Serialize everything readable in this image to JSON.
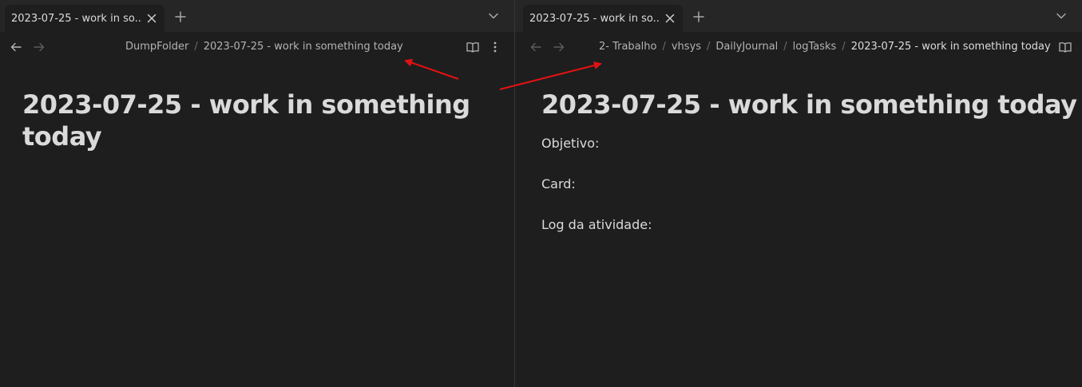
{
  "left": {
    "tab_title": "2023-07-25 - work in so...",
    "breadcrumb": [
      "DumpFolder",
      "2023-07-25  - work in something today"
    ],
    "heading_line1": "2023-07-25 - work in something",
    "heading_line2": "today"
  },
  "right": {
    "tab_title": "2023-07-25 - work in so...",
    "breadcrumb": [
      "2- Trabalho",
      "vhsys",
      "DailyJournal",
      "logTasks",
      "2023-07-25  - work in something today"
    ],
    "heading": "2023-07-25 - work in something today",
    "lines": [
      "Objetivo:",
      "Card:",
      "Log da atividade:"
    ]
  },
  "colors": {
    "background": "#1e1e1e",
    "tabbar": "#262626",
    "annotation_arrow": "#e31212"
  },
  "icons": {
    "tab_close": "close-icon",
    "new_tab": "plus-icon",
    "tab_list": "chevron-down-icon",
    "back": "arrow-left-icon",
    "forward": "arrow-right-icon",
    "reading_view": "book-open-icon",
    "more": "more-vertical-icon"
  }
}
